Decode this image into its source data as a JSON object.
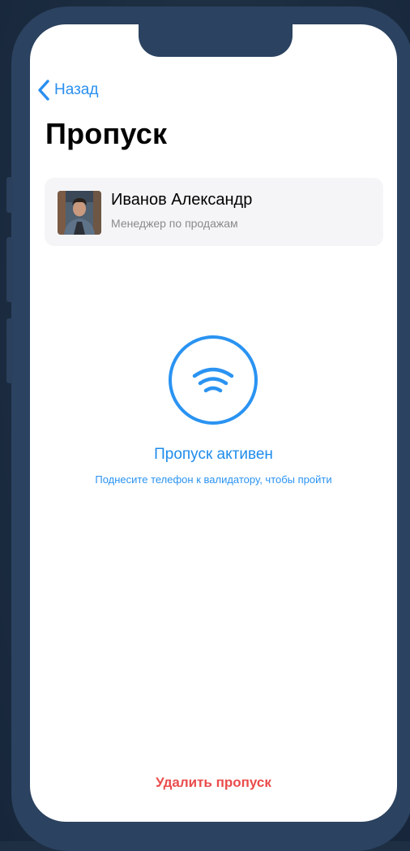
{
  "nav": {
    "back_label": "Назад"
  },
  "page": {
    "title": "Пропуск"
  },
  "profile": {
    "name": "Иванов Александр",
    "role": "Менеджер по продажам",
    "avatar_icon": "person-photo"
  },
  "pass_status": {
    "icon": "nfc-wave-icon",
    "title": "Пропуск активен",
    "subtitle": "Поднесите телефон к валидатору, чтобы пройти"
  },
  "actions": {
    "delete_label": "Удалить пропуск"
  },
  "colors": {
    "accent": "#2a93f2",
    "danger": "#ea4c4c",
    "card_bg": "#f5f5f7",
    "frame": "#2b4260",
    "background": "#1e2f44"
  }
}
